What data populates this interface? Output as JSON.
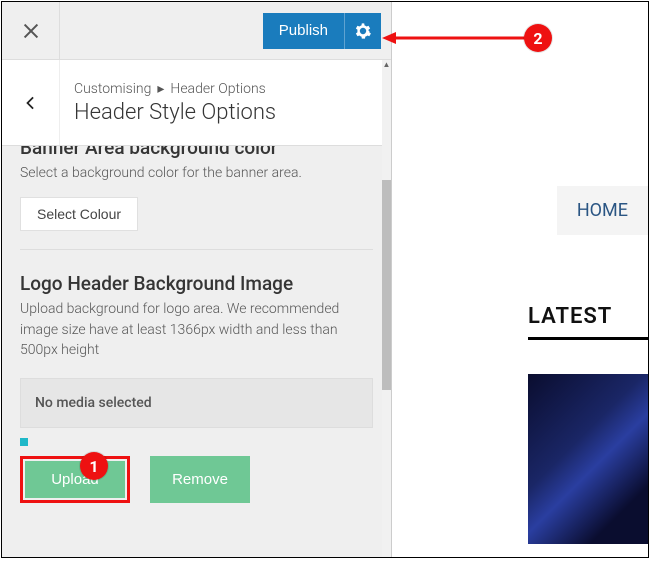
{
  "topbar": {
    "publish_label": "Publish"
  },
  "header": {
    "breadcrumb_root": "Customising",
    "breadcrumb_section": "Header Options",
    "title": "Header Style Options"
  },
  "banner_block": {
    "title": "Banner Area background color",
    "description": "Select a background color for the banner area.",
    "select_colour_label": "Select Colour"
  },
  "logo_block": {
    "title": "Logo Header Background Image",
    "description": "Upload background for logo area. We recommended image size have at least 1366px width and less than 500px height",
    "no_media_label": "No media selected",
    "upload_label": "Upload",
    "remove_label": "Remove"
  },
  "preview": {
    "home_label": "HOME",
    "latest_label": "LATEST"
  },
  "annotations": {
    "badge1": "1",
    "badge2": "2"
  }
}
